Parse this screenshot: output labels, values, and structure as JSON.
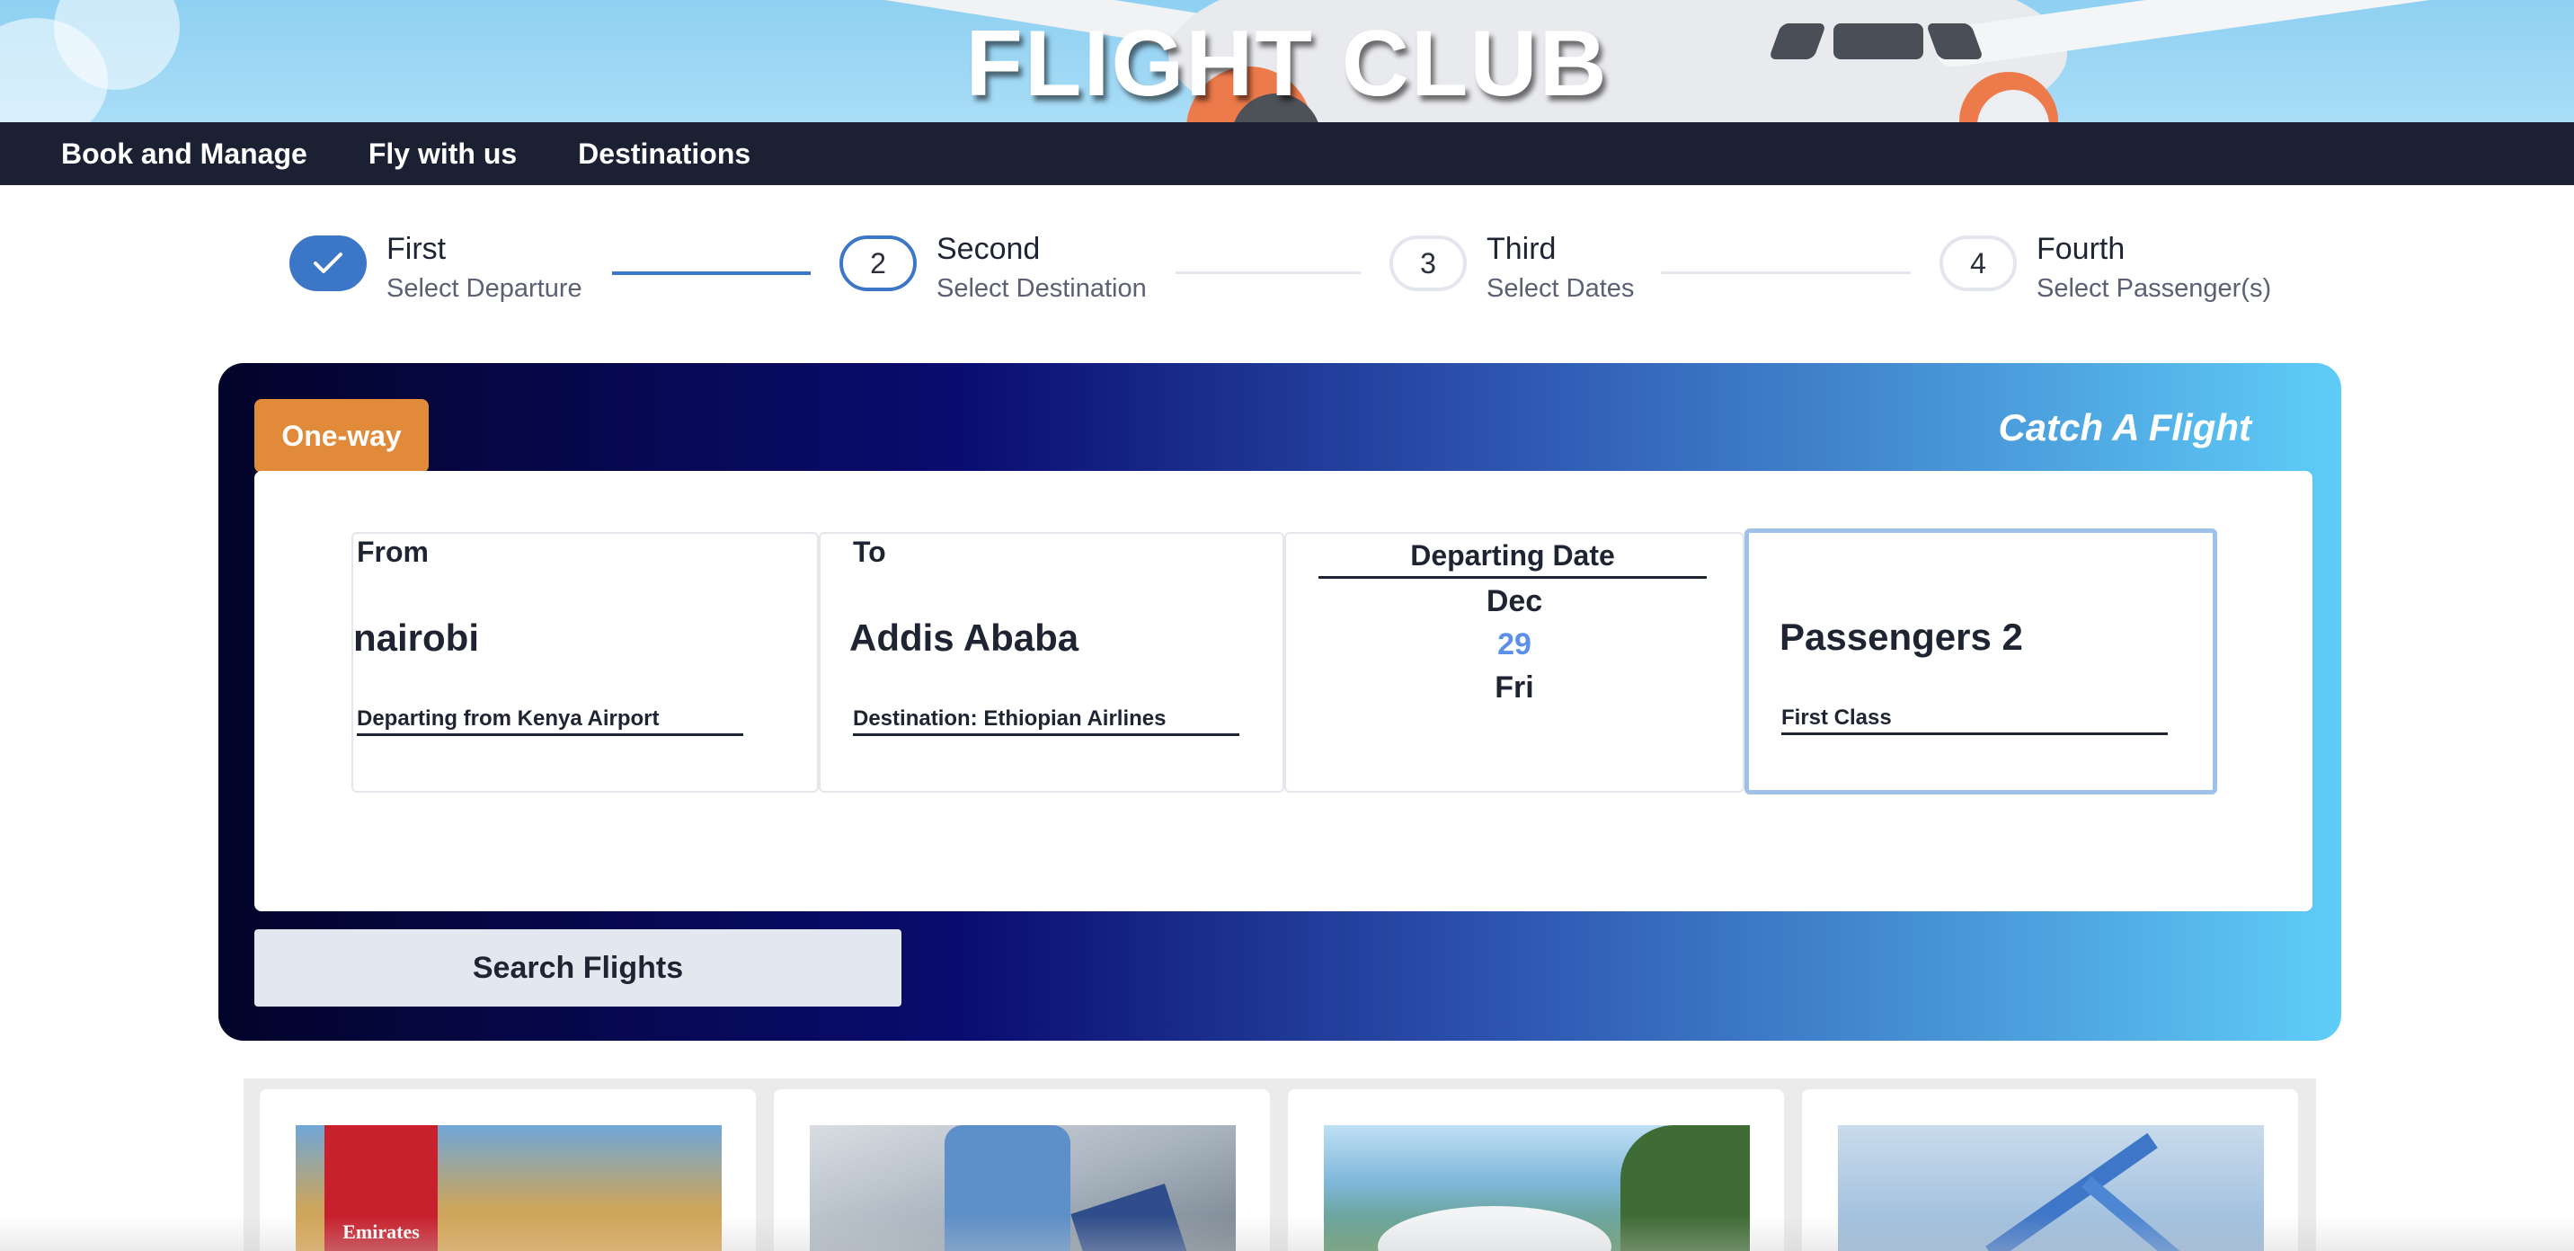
{
  "header": {
    "brand": "FLIGHT CLUB"
  },
  "nav": {
    "items": [
      "Book and Manage",
      "Fly with us",
      "Destinations"
    ]
  },
  "stepper": {
    "steps": [
      {
        "number": "",
        "title": "First",
        "subtitle": "Select Departure",
        "state": "done"
      },
      {
        "number": "2",
        "title": "Second",
        "subtitle": "Select Destination",
        "state": "active"
      },
      {
        "number": "3",
        "title": "Third",
        "subtitle": "Select Dates",
        "state": "pending"
      },
      {
        "number": "4",
        "title": "Fourth",
        "subtitle": "Select Passenger(s)",
        "state": "pending"
      }
    ]
  },
  "booking": {
    "trip_type": "One-way",
    "tagline": "Catch A Flight",
    "from": {
      "label": "From",
      "value": "nairobi",
      "note": "Departing from Kenya Airport"
    },
    "to": {
      "label": "To",
      "value": "Addis Ababa",
      "note": "Destination: Ethiopian Airlines"
    },
    "date": {
      "label": "Departing Date",
      "month": "Dec",
      "day": "29",
      "weekday": "Fri"
    },
    "passengers": {
      "value": "Passengers 2",
      "note": "First Class"
    },
    "search_label": "Search Flights"
  },
  "colors": {
    "accent": "#3c76c6",
    "trip_badge": "#e08a3a",
    "nav_bg": "#1c2033",
    "date_highlight": "#5b8fe8"
  },
  "cards": [
    {
      "image": "emirates-sunset-photo",
      "overlay_text": "Emirates"
    },
    {
      "image": "traveler-luggage-photo"
    },
    {
      "image": "person-waving-nature-photo"
    },
    {
      "image": "airplane-sky-photo"
    }
  ]
}
